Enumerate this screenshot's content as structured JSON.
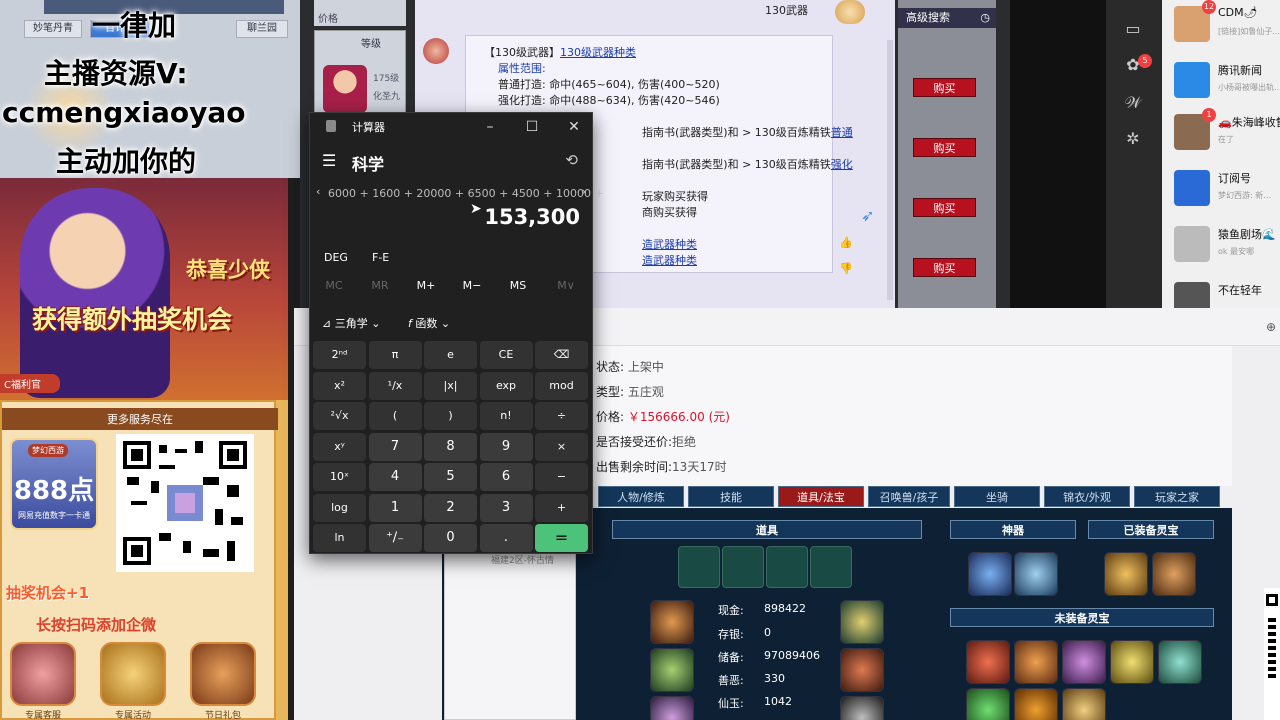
{
  "overlay": {
    "tabs": [
      "妙笔丹青",
      "百计时",
      "聊兰园"
    ],
    "lines": [
      "一律加",
      "主播资源V:",
      "ccmengxiaoyao",
      "主动加你的"
    ],
    "side_labels": [
      "价格",
      "等级"
    ],
    "level_text": "175级",
    "sub_text": "化圣九"
  },
  "promo": {
    "headline1": "恭喜少侠",
    "headline2": "获得额外抽奖机会",
    "fuli": "C福利官",
    "more_services": "更多服务尽在",
    "card_number": "888点",
    "card_tag": "梦幻西游",
    "card_sub": "网易充值数字一卡通",
    "draw_chance": "抽奖机会+1",
    "scan_text": "长按扫码添加企微",
    "icons": [
      {
        "label": "专属客服"
      },
      {
        "label": "专属活动"
      },
      {
        "label": "节日礼包"
      }
    ]
  },
  "game": {
    "header_item": "130武器",
    "lines": [
      {
        "a": "【130级武器】",
        "b": "130级武器种类"
      },
      {
        "a": "属性范围:",
        "b": ""
      },
      {
        "a": "普通打造: 命中(465~604), 伤害(400~520)",
        "b": ""
      },
      {
        "a": "强化打造: 命中(488~634), 伤害(420~546)",
        "b": ""
      },
      {
        "a": "指南书(武器类型)和 > 130级百炼精铁",
        "b": "普通"
      },
      {
        "a": "指南书(武器类型)和 > 130级百炼精铁",
        "b": "强化"
      },
      {
        "a": "玩家购买获得",
        "b": ""
      },
      {
        "a": "商购买获得",
        "b": ""
      },
      {
        "a": "",
        "b": "造武器种类"
      },
      {
        "a": "",
        "b": "造武器种类"
      }
    ],
    "advanced_search": "高级搜索",
    "buy_labels": [
      "购买",
      "购买",
      "购买",
      "购买"
    ]
  },
  "calculator": {
    "title": "计算器",
    "mode": "科学",
    "expression": "6000 + 1600 + 20000 + 6500 + 4500 + 10000 +",
    "result": "153,300",
    "deg": "DEG",
    "fe": "F-E",
    "memory": [
      "MC",
      "MR",
      "M+",
      "M−",
      "MS",
      "M∨"
    ],
    "trig": "三角学",
    "func": "函数",
    "keys": [
      "2ⁿᵈ",
      "π",
      "e",
      "CE",
      "⌫",
      "x²",
      "¹∕x",
      "|x|",
      "exp",
      "mod",
      "²√x",
      "(",
      ")",
      "n!",
      "÷",
      "xʸ",
      "7",
      "8",
      "9",
      "×",
      "10ˣ",
      "4",
      "5",
      "6",
      "−",
      "log",
      "1",
      "2",
      "3",
      "+",
      "ln",
      "⁺∕₋",
      "0",
      ".",
      "="
    ]
  },
  "listing": {
    "status_label": "状态:",
    "status": "上架中",
    "type_label": "类型:",
    "type": "五庄观",
    "price_label": "价格:",
    "price": "￥156666.00 (元)",
    "bargain_label": "是否接受还价:",
    "bargain": "拒绝",
    "time_label": "出售剩余时间:",
    "time": "13天17时",
    "tabs": [
      "人物/修炼",
      "技能",
      "道具/法宝",
      "召唤兽/孩子",
      "坐骑",
      "锦衣/外观",
      "玩家之家"
    ],
    "active_tab": "道具/法宝",
    "side_text": "福建2区-怀古情",
    "headers": {
      "items": "道具",
      "shenqi": "神器",
      "equipped": "已装备灵宝",
      "unequipped": "未装备灵宝"
    },
    "stats": [
      {
        "label": "现金:",
        "value": "898422"
      },
      {
        "label": "存银:",
        "value": "0"
      },
      {
        "label": "储备:",
        "value": "97089406"
      },
      {
        "label": "善恶:",
        "value": "330"
      },
      {
        "label": "仙玉:",
        "value": "1042"
      }
    ]
  },
  "chat": {
    "items": [
      {
        "name": "CDM🌶",
        "preview": "[链接]如鲁仙子...",
        "badge": "12",
        "color": "#d9a070"
      },
      {
        "name": "腾讯新闻",
        "preview": "小杨哥被曝出轨…",
        "badge": "",
        "color": "#2a8ae6"
      },
      {
        "name": "🚗朱海峰收售",
        "preview": "在了",
        "badge": "1",
        "color": "#8a6a50"
      },
      {
        "name": "订阅号",
        "preview": "梦幻西游: 新…",
        "badge": "",
        "color": "#2a6ad6"
      },
      {
        "name": "猿鱼剧场🌊",
        "preview": "ok 最安哪",
        "badge": "",
        "color": "#bbbbbb"
      },
      {
        "name": "不在轻年",
        "preview": "",
        "badge": "",
        "color": "#555555"
      }
    ],
    "side_badge": "5"
  },
  "colors": {
    "buy": "#b7101e",
    "tab_active": "#9a1a1a",
    "equals": "#4cc27a",
    "price": "#e0102a"
  }
}
